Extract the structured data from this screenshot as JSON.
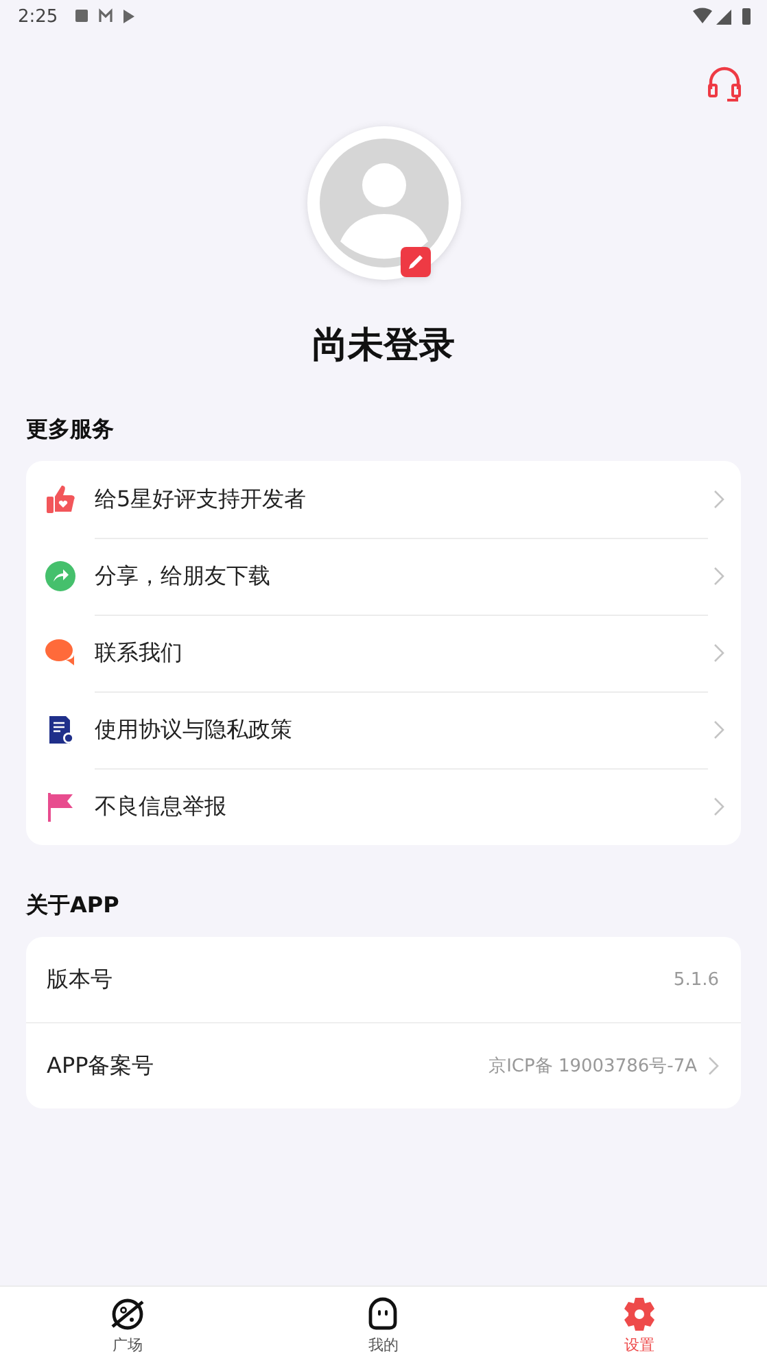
{
  "status_bar": {
    "time": "2:25"
  },
  "profile": {
    "name": "尚未登录"
  },
  "services": {
    "title": "更多服务",
    "items": [
      {
        "kind": "like",
        "label": "给5星好评支持开发者"
      },
      {
        "kind": "share",
        "label": "分享，给朋友下载"
      },
      {
        "kind": "chat",
        "label": "联系我们"
      },
      {
        "kind": "doc",
        "label": "使用协议与隐私政策"
      },
      {
        "kind": "flag",
        "label": "不良信息举报"
      }
    ]
  },
  "about": {
    "title": "关于APP",
    "items": [
      {
        "label": "版本号",
        "value": "5.1.6",
        "chevron": false
      },
      {
        "label": "APP备案号",
        "value": "京ICP备 19003786号-7A",
        "chevron": true
      }
    ]
  },
  "tab_bar": [
    {
      "kind": "planet",
      "label": "广场",
      "selected": false
    },
    {
      "kind": "ghost",
      "label": "我的",
      "selected": false
    },
    {
      "kind": "gear",
      "label": "设置",
      "selected": true
    }
  ]
}
